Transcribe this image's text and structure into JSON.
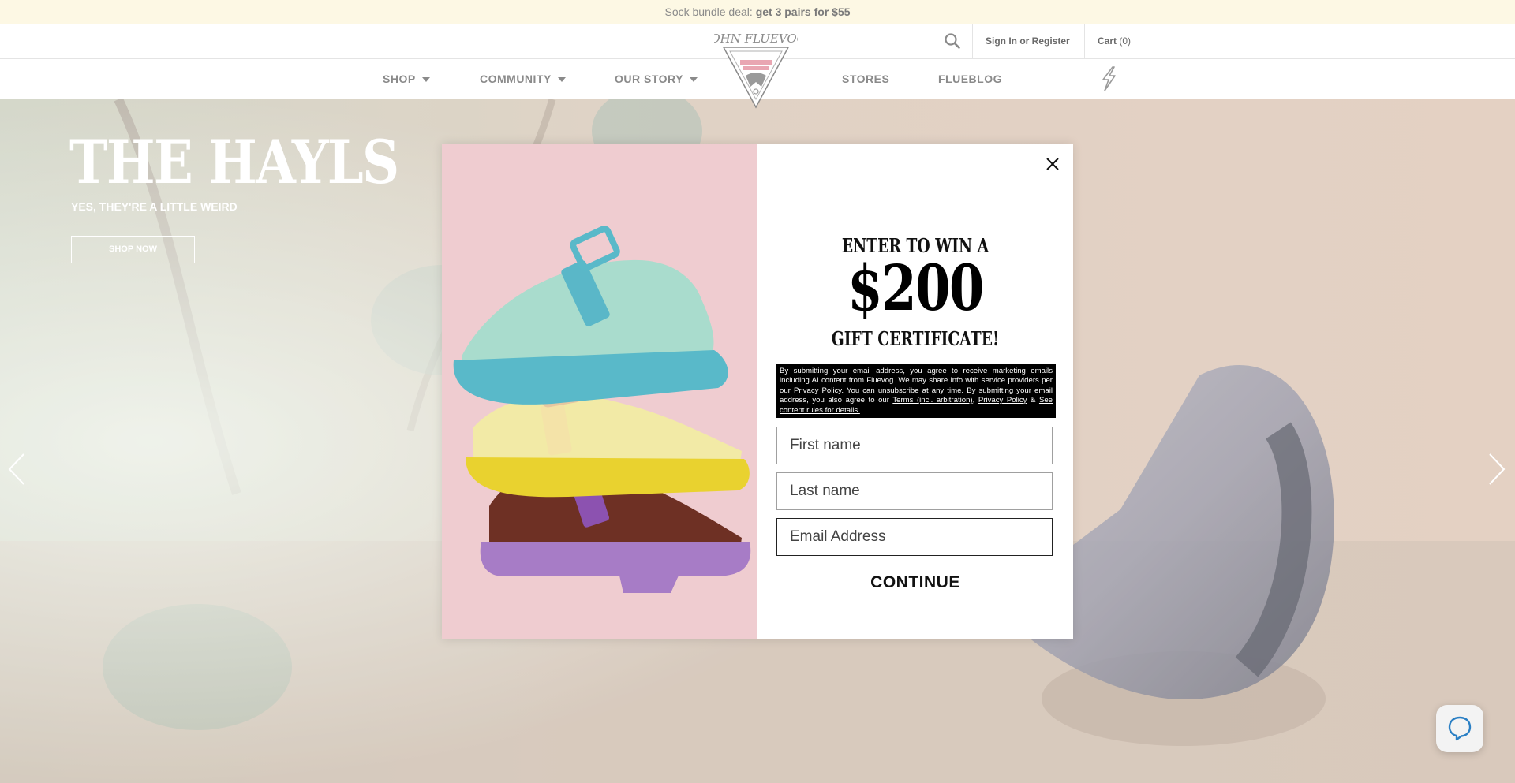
{
  "promo": {
    "lead": "Sock bundle deal:",
    "offer": "get 3 pairs for $55"
  },
  "header": {
    "signin_label": "Sign In or Register",
    "cart_label": "Cart",
    "cart_count": "(0)",
    "logo_alt": "JOHN FLUEVOG"
  },
  "nav": {
    "items": [
      {
        "label": "SHOP",
        "has_dropdown": true
      },
      {
        "label": "COMMUNITY",
        "has_dropdown": true
      },
      {
        "label": "OUR STORY",
        "has_dropdown": true
      },
      {
        "label": "STORES",
        "has_dropdown": false
      },
      {
        "label": "FLUEBLOG",
        "has_dropdown": false
      }
    ]
  },
  "hero": {
    "title": "THE HAYLS",
    "subtitle": "YES, THEY'RE A LITTLE WEIRD",
    "button_label": "SHOP NOW"
  },
  "modal": {
    "headline_top": "ENTER TO WIN A",
    "amount": "$200",
    "headline_bottom": "GIFT CERTIFICATE!",
    "legal_text": "By submitting your email address, you agree to receive marketing emails including AI content from Fluevog. We may share info with service providers per our Privacy Policy. You can unsubscribe at any time. By submitting your email address, you also agree to our ",
    "legal_link_terms": "Terms (incl. arbitration)",
    "legal_sep1": ", ",
    "legal_link_privacy": "Privacy Policy",
    "legal_sep2": " & ",
    "legal_link_rules": "See content rules for details.",
    "first_name_placeholder": "First name",
    "last_name_placeholder": "Last name",
    "email_placeholder": "Email Address",
    "continue_label": "CONTINUE"
  },
  "icons": {
    "search": "search-icon",
    "close": "close-icon",
    "bolt": "lightning-bolt-icon",
    "prev": "chevron-left-icon",
    "next": "chevron-right-icon",
    "help": "chat-bubble-icon"
  },
  "colors": {
    "promo_bg": "#fdf8e4",
    "nav_text": "#8a8a8a",
    "hero_tint": "#d9c7b8",
    "modal_image_bg": "#efccd0"
  }
}
